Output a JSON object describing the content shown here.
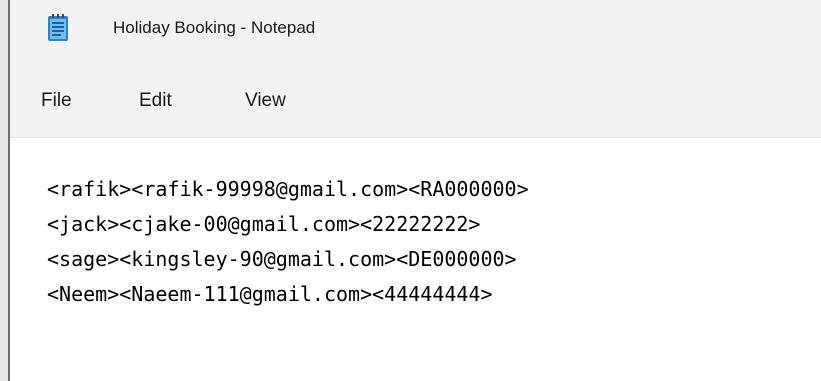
{
  "window": {
    "title": "Holiday Booking - Notepad",
    "icon": "notepad-icon"
  },
  "menu": {
    "items": [
      "File",
      "Edit",
      "View"
    ]
  },
  "document": {
    "lines": [
      "<rafik><rafik-99998@gmail.com><RA000000>",
      "<jack><cjake-00@gmail.com><22222222>",
      "<sage><kingsley-90@gmail.com><DE000000>",
      "<Neem><Naeem-111@gmail.com><44444444>"
    ]
  }
}
